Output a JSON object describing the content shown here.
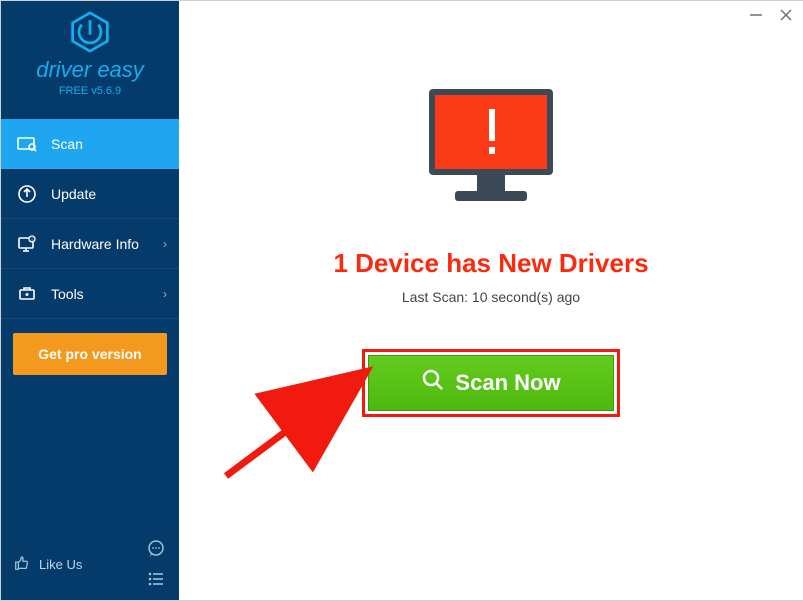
{
  "brand": {
    "name": "driver easy",
    "version": "FREE v5.6.9"
  },
  "sidebar": {
    "items": [
      {
        "label": "Scan",
        "has_chevron": false
      },
      {
        "label": "Update",
        "has_chevron": false
      },
      {
        "label": "Hardware Info",
        "has_chevron": true
      },
      {
        "label": "Tools",
        "has_chevron": true
      }
    ],
    "pro_button": "Get pro version",
    "like_us": "Like Us"
  },
  "main": {
    "headline": "1 Device has New Drivers",
    "last_scan": "Last Scan: 10 second(s) ago",
    "scan_button": "Scan Now"
  }
}
